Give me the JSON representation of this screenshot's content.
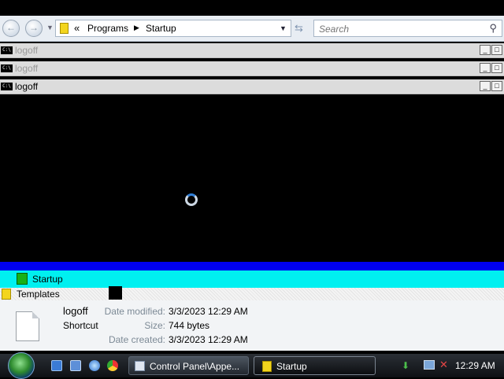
{
  "explorer": {
    "breadcrumb_overflow": "«",
    "breadcrumb": [
      "Programs",
      "Startup"
    ],
    "breadcrumb_sep": "▶",
    "search_placeholder": "Search"
  },
  "consoles": [
    {
      "title": "logoff",
      "dim": true
    },
    {
      "title": "logoff",
      "dim": true
    },
    {
      "title": "logoff",
      "dim": false
    }
  ],
  "cmd_icon_text": "C:\\",
  "folder_list": {
    "items": [
      "Startup",
      "Templates"
    ],
    "selected": "Startup"
  },
  "details": {
    "name": "logoff",
    "type": "Shortcut",
    "date_modified_label": "Date modified:",
    "date_modified": "3/3/2023 12:29 AM",
    "size_label": "Size:",
    "size": "744 bytes",
    "date_created_label": "Date created:",
    "date_created": "3/3/2023 12:29 AM"
  },
  "taskbar": {
    "buttons": [
      {
        "label": "Control Panel\\Appe...",
        "icon": "control-panel-icon"
      },
      {
        "label": "Startup",
        "icon": "folder-icon"
      }
    ],
    "clock": "12:29 AM"
  },
  "colors": {
    "selection_cyan": "#00f0f0",
    "selection_blue": "#0000ee",
    "folder_yellow": "#f3d51d",
    "folder_green": "#17b117"
  }
}
